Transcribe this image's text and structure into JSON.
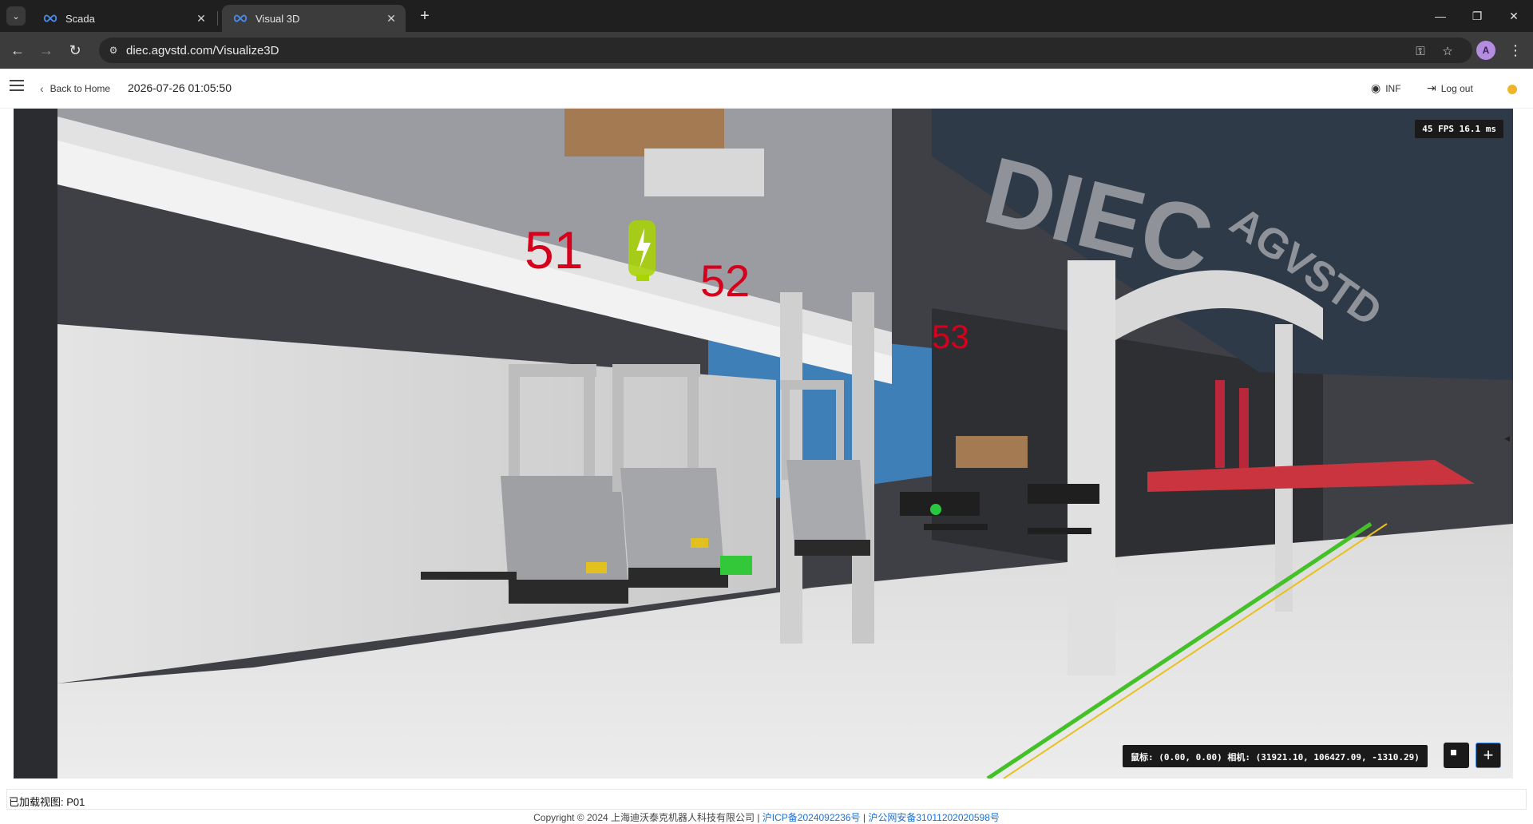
{
  "browser": {
    "tabs": [
      {
        "title": "Scada",
        "active": false
      },
      {
        "title": "Visual 3D",
        "active": true
      }
    ],
    "url": "diec.agvstd.com/Visualize3D",
    "profile_initial": "A"
  },
  "header": {
    "back_label": "Back to Home",
    "datetime": "2026-07-26 01:05:50",
    "inf_label": "INF",
    "logout_label": "Log out",
    "status_color": "#f0b429"
  },
  "viewport": {
    "fps_text": "45 FPS  16.1 ms",
    "coords_text": "鼠标: (0.00, 0.00)  相机: (31921.10, 106427.09, -1310.29)",
    "station_labels": [
      "51",
      "52",
      "53"
    ],
    "signage": [
      "DIEC",
      "AGVSTD"
    ],
    "colors": {
      "station_label": "#d6001c",
      "charger": "#a8d400",
      "floor": "#e8e8e8",
      "wall": "#d9d9d9",
      "accent_blue": "#3f7fb8",
      "accent_red": "#c9343f"
    }
  },
  "footer": {
    "loaded_view": "已加载视图: P01",
    "copyright_prefix": "Copyright © 2024 上海迪沃泰克机器人科技有限公司 | ",
    "icp": "沪ICP备2024092236号",
    "separator": " | ",
    "police": "沪公网安备31011202020598号"
  }
}
